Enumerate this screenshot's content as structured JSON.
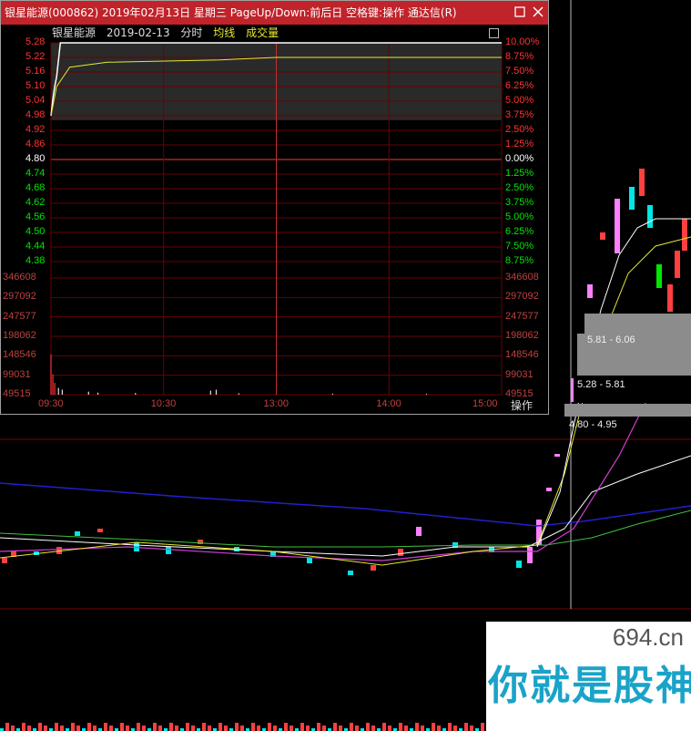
{
  "window": {
    "title": "银星能源(000862) 2019年02月13日 星期三 PageUp/Down:前后日 空格键:操作 通达信(R)",
    "restore_icon": "restore-icon",
    "close_icon": "close-icon"
  },
  "header": {
    "stock_name": "银星能源",
    "date": "2019-02-13",
    "mode": "分时",
    "avg_label": "均线",
    "vol_label": "成交量"
  },
  "price_labels": [
    "5.28",
    "5.22",
    "5.16",
    "5.10",
    "5.04",
    "4.98",
    "4.92",
    "4.86",
    "4.80",
    "4.74",
    "4.68",
    "4.62",
    "4.56",
    "4.50",
    "4.44",
    "4.38"
  ],
  "pct_labels": [
    "10.00%",
    "8.75%",
    "7.50%",
    "6.25%",
    "5.00%",
    "3.75%",
    "2.50%",
    "1.25%",
    "0.00%",
    "1.25%",
    "2.50%",
    "3.75%",
    "5.00%",
    "6.25%",
    "7.50%",
    "8.75%"
  ],
  "volume_labels": [
    "346608",
    "297092",
    "247577",
    "198062",
    "148546",
    "99031",
    "49515"
  ],
  "time_labels": [
    "09:30",
    "10:30",
    "13:00",
    "14:00",
    "15:00"
  ],
  "operate_button": "操作",
  "price_zones": [
    "5.81 - 6.06",
    "5.28 - 5.81",
    "4.80 - 4.95"
  ],
  "watermark": {
    "domain": "694.cn",
    "slogan": "你就是股神"
  },
  "colors": {
    "up": "#ff3232",
    "down": "#00e600",
    "flat": "#ffffff",
    "avg_line": "#e8e830",
    "grid": "#8b0000",
    "title_bar": "#c0232a"
  },
  "chart_data": {
    "type": "line",
    "title": "银星能源 2019-02-13 分时",
    "xlabel": "",
    "ylabel": "",
    "x_range": [
      "09:30",
      "15:00"
    ],
    "ylim": [
      4.38,
      5.28
    ],
    "prev_close": 4.8,
    "series": [
      {
        "name": "分时",
        "x": [
          "09:30",
          "09:31",
          "09:32",
          "09:33",
          "09:35",
          "09:40",
          "15:00"
        ],
        "values": [
          4.98,
          5.05,
          5.1,
          5.14,
          5.28,
          5.28,
          5.28
        ]
      },
      {
        "name": "均线",
        "x": [
          "09:30",
          "09:33",
          "09:40",
          "10:00",
          "11:00",
          "13:00",
          "15:00"
        ],
        "values": [
          4.98,
          5.1,
          5.18,
          5.2,
          5.21,
          5.22,
          5.22
        ]
      }
    ],
    "volume_max": 346608,
    "volume_ticks": [
      346608,
      297092,
      247577,
      198062,
      148546,
      99031,
      49515
    ]
  }
}
